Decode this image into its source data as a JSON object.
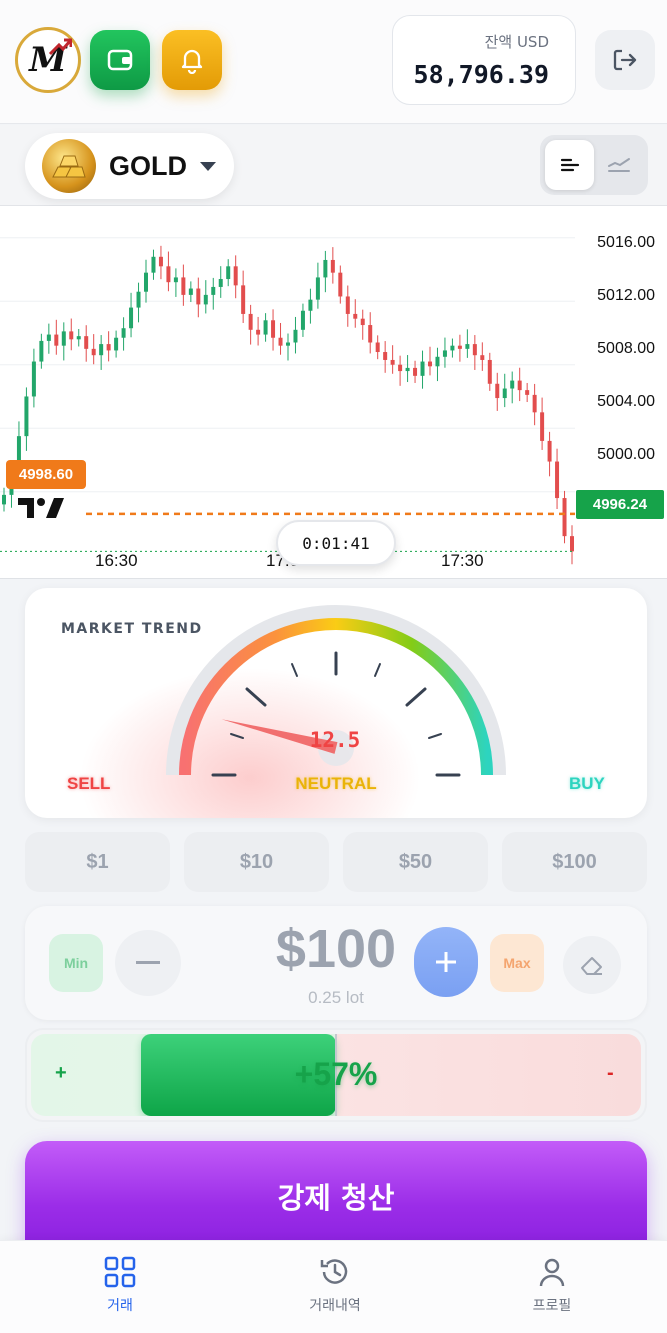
{
  "header": {
    "logo_letter": "M",
    "balance_label": "잔액 USD",
    "balance_value": "58,796.39"
  },
  "asset": {
    "name": "GOLD"
  },
  "chart_data": {
    "type": "candlestick",
    "y_ticks": [
      "5016.00",
      "5012.00",
      "5008.00",
      "5004.00",
      "5000.00"
    ],
    "x_ticks": [
      "16:30",
      "17:00",
      "17:30"
    ],
    "ylim": [
      4994.5,
      5018
    ],
    "entry_price": "4998.60",
    "current_price": "4996.24",
    "timer": "0:01:41",
    "close_series": [
      4999.8,
      5001.2,
      5003.5,
      5006.0,
      5008.2,
      5009.5,
      5009.9,
      5009.2,
      5010.1,
      5009.6,
      5009.8,
      5009.0,
      5008.6,
      5009.3,
      5008.9,
      5009.7,
      5010.3,
      5011.6,
      5012.6,
      5013.8,
      5014.8,
      5014.2,
      5013.2,
      5013.5,
      5012.4,
      5012.8,
      5011.8,
      5012.4,
      5012.9,
      5013.4,
      5014.2,
      5013.0,
      5011.2,
      5010.2,
      5009.9,
      5010.8,
      5009.7,
      5009.2,
      5009.4,
      5010.2,
      5011.4,
      5012.1,
      5013.5,
      5014.6,
      5013.8,
      5012.3,
      5011.2,
      5010.9,
      5010.5,
      5009.4,
      5008.8,
      5008.3,
      5008.0,
      5007.6,
      5007.8,
      5007.3,
      5008.2,
      5007.9,
      5008.5,
      5008.9,
      5009.2,
      5009.0,
      5009.3,
      5008.6,
      5008.3,
      5006.8,
      5005.9,
      5006.5,
      5007.0,
      5006.4,
      5006.1,
      5005.0,
      5003.2,
      5001.9,
      4999.6,
      4997.2,
      4996.24
    ]
  },
  "trend": {
    "title": "MARKET TREND",
    "value": "12.5",
    "value_fraction": 0.125,
    "sell_label": "SELL",
    "neutral_label": "NEUTRAL",
    "buy_label": "BUY"
  },
  "quick_amounts": [
    "$1",
    "$10",
    "$50",
    "$100"
  ],
  "amount": {
    "min_label": "Min",
    "max_label": "Max",
    "value": "$100",
    "lot": "0.25 lot"
  },
  "ratio": {
    "plus": "+",
    "minus": "-",
    "text": "+57%",
    "fill_fraction": 0.57
  },
  "liquidate_label": "강제 청산",
  "nav": {
    "items": [
      {
        "label": "거래",
        "active": true
      },
      {
        "label": "거래내역",
        "active": false
      },
      {
        "label": "프로필",
        "active": false
      }
    ]
  },
  "colors": {
    "up": "#22a66a",
    "down": "#e24d4d",
    "accent": "#2563eb",
    "liquidate": "#9b2de8"
  }
}
